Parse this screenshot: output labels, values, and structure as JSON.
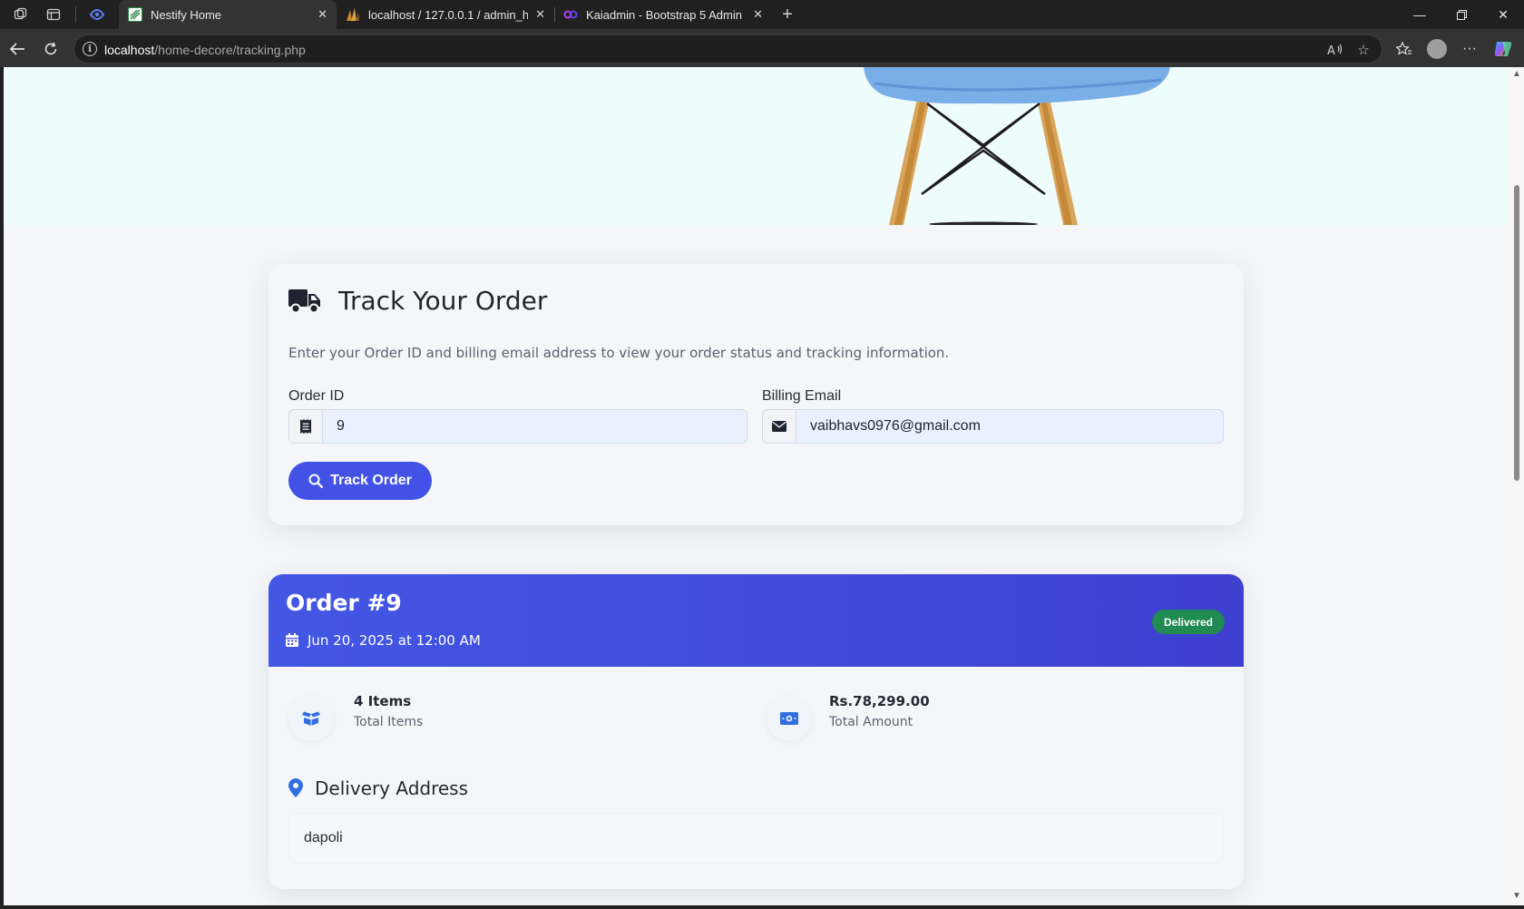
{
  "browser": {
    "tabs": [
      {
        "title": "Nestify Home",
        "active": true
      },
      {
        "title": "localhost / 127.0.0.1 / admin_hom",
        "active": false
      },
      {
        "title": "Kaiadmin - Bootstrap 5 Admin Da",
        "active": false
      }
    ],
    "url": {
      "host": "localhost",
      "path": "/home-decore/tracking.php"
    }
  },
  "track_card": {
    "title": "Track Your Order",
    "description": "Enter your Order ID and billing email address to view your order status and tracking information.",
    "order_id_label": "Order ID",
    "order_id_value": "9",
    "email_label": "Billing Email",
    "email_value": "vaibhavs0976@gmail.com",
    "button_label": "Track Order"
  },
  "order": {
    "title": "Order #9",
    "date": "Jun 20, 2025 at 12:00 AM",
    "status": "Delivered",
    "items_value": "4 Items",
    "items_label": "Total Items",
    "amount_value": "Rs.78,299.00",
    "amount_label": "Total Amount",
    "address_title": "Delivery Address",
    "address": "dapoli"
  },
  "colors": {
    "primary": "#4352e6",
    "status_delivered": "#1f8a52",
    "icon_blue": "#2f6fe0"
  }
}
